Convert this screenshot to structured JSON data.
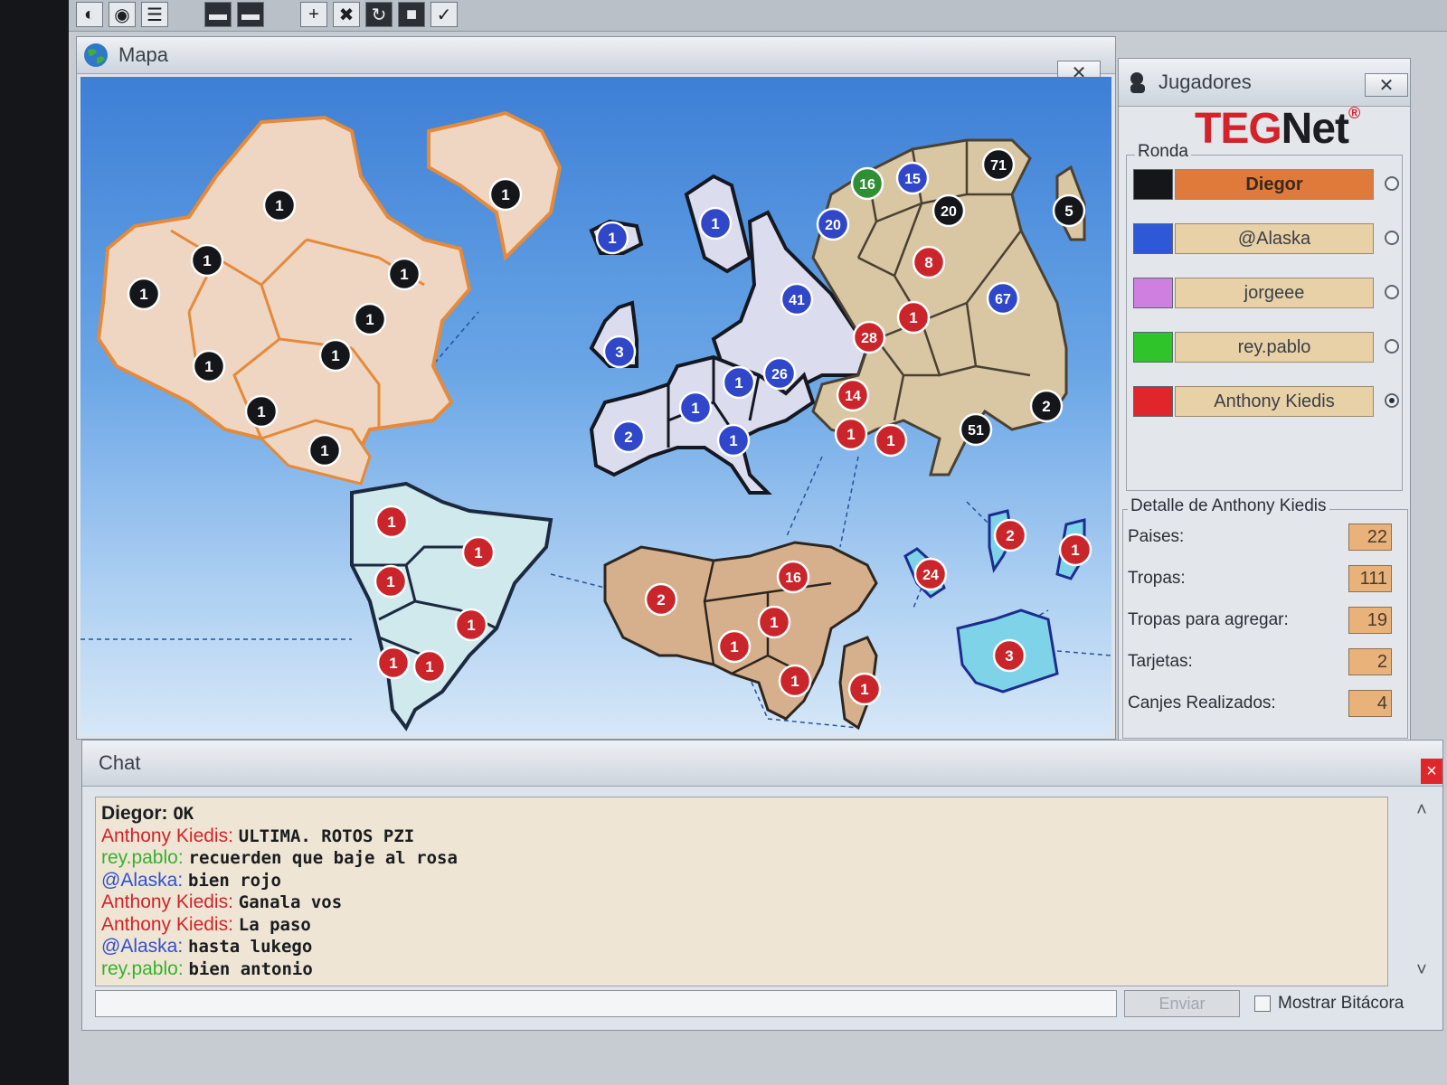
{
  "toolbar": {
    "buttons": [
      {
        "name": "globe-button",
        "glyph": "◐"
      },
      {
        "name": "checkmark-circle-button",
        "glyph": "◉"
      },
      {
        "name": "list-button",
        "glyph": "☰"
      },
      {
        "name": "dark-card-button-1",
        "glyph": "▬"
      },
      {
        "name": "dark-card-button-2",
        "glyph": "▬"
      },
      {
        "name": "add-button",
        "glyph": "+"
      },
      {
        "name": "remove-button",
        "glyph": "✖"
      },
      {
        "name": "refresh-button",
        "glyph": "↻"
      },
      {
        "name": "cards-button",
        "glyph": "■"
      },
      {
        "name": "confirm-button",
        "glyph": "✓"
      }
    ]
  },
  "map_window": {
    "title": "Mapa",
    "close": "✕"
  },
  "players_window": {
    "title": "Jugadores",
    "close": "✕",
    "logo_a": "TEG",
    "logo_b": "Net",
    "logo_mark": "®",
    "ronda_label": "Ronda",
    "players": [
      {
        "name": "Diegor",
        "color": "#15161a",
        "active": true,
        "selected": false
      },
      {
        "name": "@Alaska",
        "color": "#2f58d8",
        "active": false,
        "selected": false
      },
      {
        "name": "jorgeee",
        "color": "#cf7fe0",
        "active": false,
        "selected": false
      },
      {
        "name": "rey.pablo",
        "color": "#2fc42a",
        "active": false,
        "selected": false
      },
      {
        "name": "Anthony Kiedis",
        "color": "#e0262b",
        "active": false,
        "selected": true
      }
    ],
    "detail_label": "Detalle de Anthony Kiedis",
    "details": [
      {
        "label": "Paises:",
        "value": "22"
      },
      {
        "label": "Tropas:",
        "value": "111"
      },
      {
        "label": "Tropas para agregar:",
        "value": "19"
      },
      {
        "label": "Tarjetas:",
        "value": "2"
      },
      {
        "label": "Canjes Realizados:",
        "value": "4"
      }
    ]
  },
  "chat": {
    "title": "Chat",
    "close": "×",
    "messages": [
      {
        "who": "Diegor:",
        "who_color": "#1b1d22",
        "text": "OK"
      },
      {
        "who": "Anthony Kiedis:",
        "who_color": "#d3222a",
        "text": "ULTIMA. ROTOS PZI"
      },
      {
        "who": "rey.pablo:",
        "who_color": "#38b02f",
        "text": "recuerden que baje al rosa"
      },
      {
        "who": "@Alaska:",
        "who_color": "#2f4fd2",
        "text": "bien rojo"
      },
      {
        "who": "Anthony Kiedis:",
        "who_color": "#d3222a",
        "text": "Ganala vos"
      },
      {
        "who": "Anthony Kiedis:",
        "who_color": "#d3222a",
        "text": "La paso"
      },
      {
        "who": "@Alaska:",
        "who_color": "#2f4fd2",
        "text": "hasta lukego"
      },
      {
        "who": "rey.pablo:",
        "who_color": "#38b02f",
        "text": "bien antonio"
      }
    ],
    "input_value": "",
    "send_label": "Enviar",
    "show_log_label": "Mostrar Bitácora",
    "scroll_up": "˄",
    "scroll_down": "˅"
  },
  "map": {
    "armies": [
      {
        "n": "1",
        "owner": "black"
      },
      {
        "n": "1",
        "owner": "black"
      },
      {
        "n": "1",
        "owner": "black"
      },
      {
        "n": "1",
        "owner": "black"
      },
      {
        "n": "1",
        "owner": "black"
      },
      {
        "n": "1",
        "owner": "black"
      },
      {
        "n": "1",
        "owner": "black"
      },
      {
        "n": "1",
        "owner": "black"
      },
      {
        "n": "1",
        "owner": "black"
      },
      {
        "n": "1",
        "owner": "black"
      },
      {
        "n": "1",
        "owner": "blue"
      },
      {
        "n": "1",
        "owner": "blue"
      },
      {
        "n": "3",
        "owner": "blue"
      },
      {
        "n": "41",
        "owner": "blue"
      },
      {
        "n": "26",
        "owner": "blue"
      },
      {
        "n": "1",
        "owner": "blue"
      },
      {
        "n": "1",
        "owner": "blue"
      },
      {
        "n": "2",
        "owner": "blue"
      },
      {
        "n": "1",
        "owner": "blue"
      },
      {
        "n": "16",
        "owner": "green"
      },
      {
        "n": "15",
        "owner": "blue"
      },
      {
        "n": "71",
        "owner": "black"
      },
      {
        "n": "20",
        "owner": "blue"
      },
      {
        "n": "20",
        "owner": "black"
      },
      {
        "n": "5",
        "owner": "black"
      },
      {
        "n": "8",
        "owner": "red"
      },
      {
        "n": "67",
        "owner": "blue"
      },
      {
        "n": "1",
        "owner": "red"
      },
      {
        "n": "28",
        "owner": "red"
      },
      {
        "n": "14",
        "owner": "red"
      },
      {
        "n": "1",
        "owner": "red"
      },
      {
        "n": "1",
        "owner": "red"
      },
      {
        "n": "2",
        "owner": "black"
      },
      {
        "n": "51",
        "owner": "black"
      },
      {
        "n": "1",
        "owner": "red"
      },
      {
        "n": "1",
        "owner": "red"
      },
      {
        "n": "1",
        "owner": "red"
      },
      {
        "n": "1",
        "owner": "red"
      },
      {
        "n": "1",
        "owner": "red"
      },
      {
        "n": "1",
        "owner": "red"
      },
      {
        "n": "2",
        "owner": "red"
      },
      {
        "n": "16",
        "owner": "red"
      },
      {
        "n": "1",
        "owner": "red"
      },
      {
        "n": "1",
        "owner": "red"
      },
      {
        "n": "1",
        "owner": "red"
      },
      {
        "n": "1",
        "owner": "red"
      },
      {
        "n": "24",
        "owner": "red"
      },
      {
        "n": "2",
        "owner": "red"
      },
      {
        "n": "1",
        "owner": "red"
      },
      {
        "n": "3",
        "owner": "red"
      }
    ],
    "colors": {
      "black": "#15161a",
      "blue": "#2f47c8",
      "red": "#c9252b",
      "green": "#2f8f35"
    }
  }
}
